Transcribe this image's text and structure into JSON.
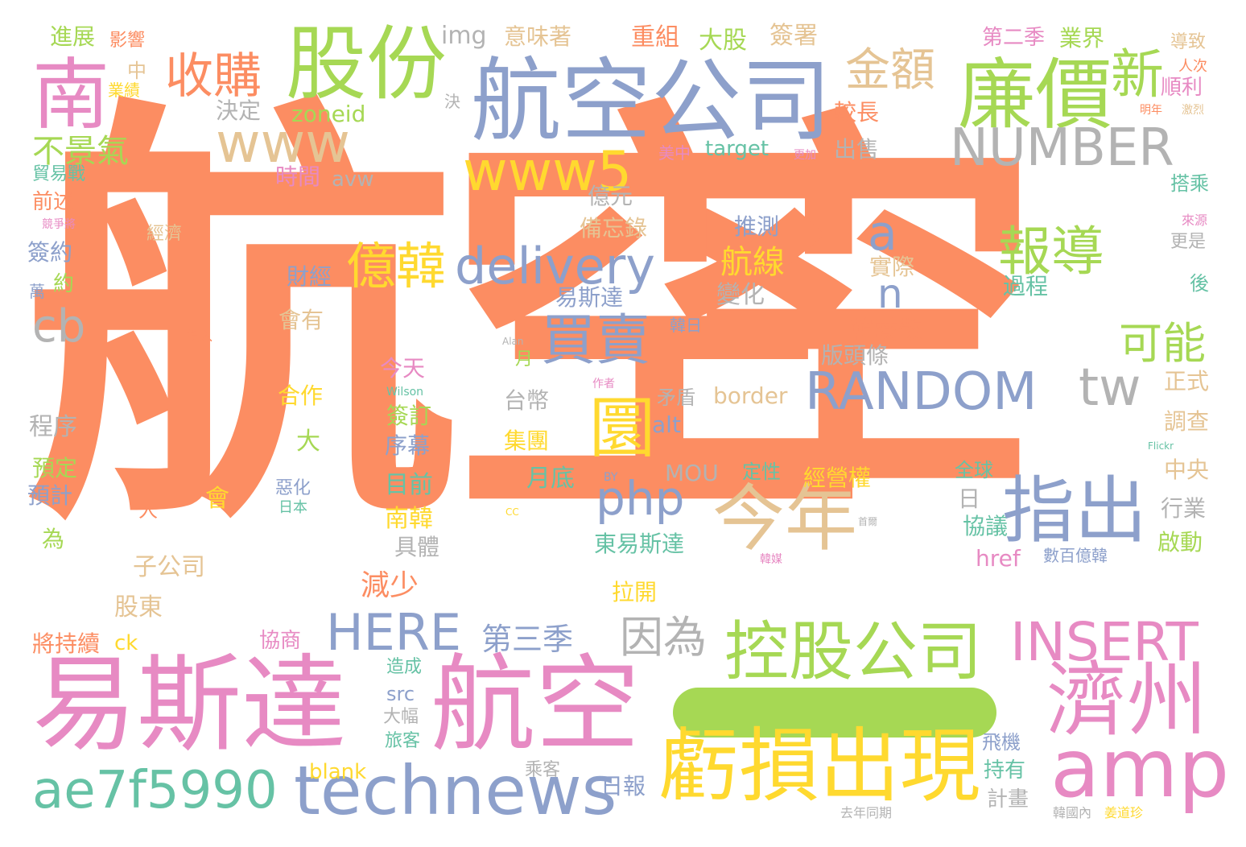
{
  "palette": {
    "orange": "#fc8d62",
    "blue": "#8da0cb",
    "pink": "#e78ac3",
    "green": "#a6d854",
    "yellow": "#ffd92f",
    "tan": "#e5c494",
    "gray": "#b3b3b3",
    "teal": "#66c2a5"
  },
  "words": [
    "航空",
    "空",
    "易斯達",
    "航空",
    "航空公司",
    "股份",
    "廉價",
    "南",
    "濟州",
    "虧損出現",
    "控股公司",
    "amp",
    "technews",
    "ae7f5990",
    "指出",
    "今年",
    "INSERT",
    "RANDOM",
    "NUMBER",
    "HERE",
    "www",
    "www5",
    "delivery",
    "php",
    "tw",
    "cb",
    "a",
    "n",
    "報導",
    "買賣",
    "億韓",
    "收購",
    "金額",
    "新",
    "不景氣",
    "圜",
    "可能",
    "因為",
    "第三季",
    "減少",
    "航線",
    "推測",
    "變化",
    "韓愛敬",
    "版頭條",
    "合作",
    "簽訂",
    "序幕",
    "集團",
    "月底",
    "目前",
    "南韓",
    "具體",
    "子公司",
    "股東",
    "協商",
    "將持續",
    "造成",
    "大幅",
    "旅客",
    "乘客",
    "日報",
    "計畫",
    "持有",
    "飛機",
    "去年同期",
    "韓國內",
    "姜道珍",
    "東易斯達",
    "經營權",
    "拉開",
    "MOU",
    "alt",
    "border",
    "href",
    "數百億韓",
    "協議",
    "日",
    "全球",
    "定性",
    "中央",
    "行業",
    "啟動",
    "預定",
    "預計",
    "程序",
    "大",
    "會",
    "人",
    "惡化",
    "日本",
    "為",
    "進展",
    "影響",
    "中",
    "業績",
    "決",
    "決定",
    "zoneid",
    "img",
    "意味著",
    "重組",
    "大股",
    "簽署",
    "第二季",
    "業界",
    "導致",
    "人次",
    "順利",
    "明年",
    "激烈",
    "較長",
    "出售",
    "target",
    "美中",
    "更加",
    "貿易戰",
    "前述",
    "競爭將",
    "經濟",
    "簽約",
    "約",
    "萬",
    "時間",
    "avw",
    "億元",
    "備忘錄",
    "財經",
    "會有",
    "易斯達",
    "實際",
    "過程",
    "搭乘",
    "來源",
    "更是",
    "後",
    "韓日",
    "今天",
    "月",
    "Alan",
    "Wilson",
    "作者",
    "矛盾",
    "台幣",
    "正式",
    "調查",
    "投入",
    "src",
    "blank",
    "ck",
    "BY",
    "CC",
    "Flickr",
    "首爾",
    "韓媒"
  ]
}
